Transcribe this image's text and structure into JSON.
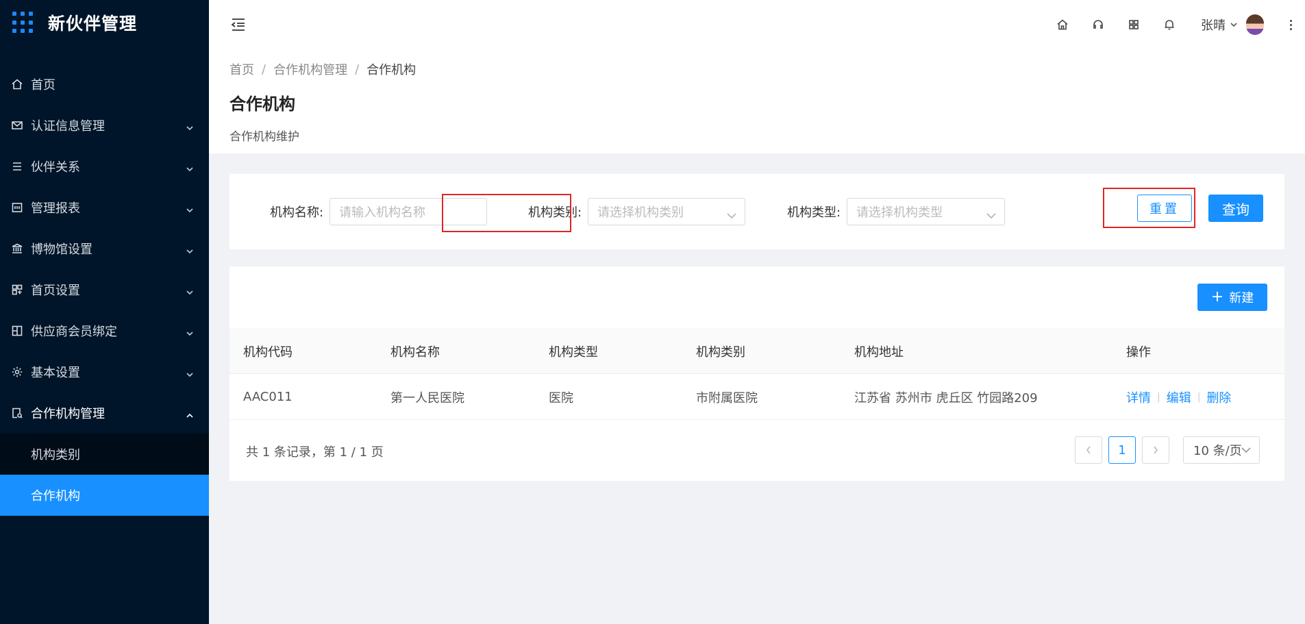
{
  "app": {
    "title": "新伙伴管理"
  },
  "sidebar": {
    "items": [
      {
        "label": "首页",
        "icon": "home-icon"
      },
      {
        "label": "认证信息管理",
        "icon": "mail-icon"
      },
      {
        "label": "伙伴关系",
        "icon": "list-icon"
      },
      {
        "label": "管理报表",
        "icon": "report-icon"
      },
      {
        "label": "博物馆设置",
        "icon": "museum-icon"
      },
      {
        "label": "首页设置",
        "icon": "layout-icon"
      },
      {
        "label": "供应商会员绑定",
        "icon": "bind-icon"
      },
      {
        "label": "基本设置",
        "icon": "gear-icon"
      },
      {
        "label": "合作机构管理",
        "icon": "org-icon"
      }
    ],
    "sub_items": [
      {
        "label": "机构类别"
      },
      {
        "label": "合作机构"
      }
    ]
  },
  "header": {
    "user_name": "张晴"
  },
  "breadcrumb": {
    "items": [
      "首页",
      "合作机构管理",
      "合作机构"
    ]
  },
  "page": {
    "title": "合作机构",
    "description": "合作机构维护"
  },
  "search": {
    "name_label": "机构名称:",
    "name_placeholder": "请输入机构名称",
    "category_label": "机构类别:",
    "category_placeholder": "请选择机构类别",
    "type_label": "机构类型:",
    "type_placeholder": "请选择机构类型",
    "reset_label": "重置",
    "query_label": "查询"
  },
  "toolbar": {
    "new_label": "新建"
  },
  "table": {
    "columns": [
      "机构代码",
      "机构名称",
      "机构类型",
      "机构类别",
      "机构地址",
      "操作"
    ],
    "rows": [
      {
        "code": "AAC011",
        "name": "第一人民医院",
        "type": "医院",
        "category": "市附属医院",
        "address": "江苏省 苏州市 虎丘区 竹园路209",
        "actions": [
          "详情",
          "编辑",
          "删除"
        ]
      }
    ]
  },
  "pagination": {
    "summary": "共 1 条记录，第 1 / 1 页",
    "current_page": "1",
    "page_size": "10 条/页"
  },
  "colors": {
    "primary": "#1890ff",
    "sidebar_bg": "#001529",
    "highlight": "#e02424"
  }
}
